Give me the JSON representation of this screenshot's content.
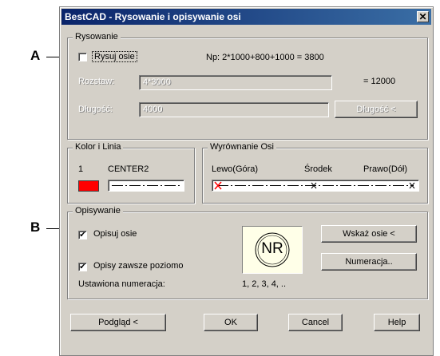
{
  "callouts": {
    "a": "A",
    "b": "B"
  },
  "window": {
    "title": "BestCAD - Rysowanie i opisywanie osi",
    "close_glyph": "✕"
  },
  "rysowanie": {
    "legend": "Rysowanie",
    "draw_axes_label": "Rysuj osie",
    "draw_axes_checked": false,
    "example": "Np: 2*1000+800+1000 = 3800",
    "spacing_label": "Rozstaw:",
    "spacing_value": "4*3000",
    "spacing_total": "= 12000",
    "length_label": "Długość:",
    "length_value": "4000",
    "length_button": "Długość <"
  },
  "kolor": {
    "legend": "Kolor i Linia",
    "color_index": "1",
    "linetype": "CENTER2",
    "color_hex": "#ff0000"
  },
  "wyrownanie": {
    "legend": "Wyrównanie Osi",
    "left": "Lewo(Góra)",
    "center": "Środek",
    "right": "Prawo(Dół)"
  },
  "opisywanie": {
    "legend": "Opisywanie",
    "describe_axes_label": "Opisuj osie",
    "describe_axes_checked": true,
    "always_horizontal_label": "Opisy zawsze poziomo",
    "always_horizontal_checked": true,
    "numbering_label": "Ustawiona numeracja:",
    "numbering_value": "1, 2, 3, 4, ..",
    "preview_symbol": "NR",
    "point_axes_button": "Wskaż osie <",
    "numbering_button": "Numeracja.."
  },
  "footer": {
    "preview_button": "Podgląd <",
    "ok_button": "OK",
    "cancel_button": "Cancel",
    "help_button": "Help"
  },
  "icons": {
    "check": "✔"
  }
}
